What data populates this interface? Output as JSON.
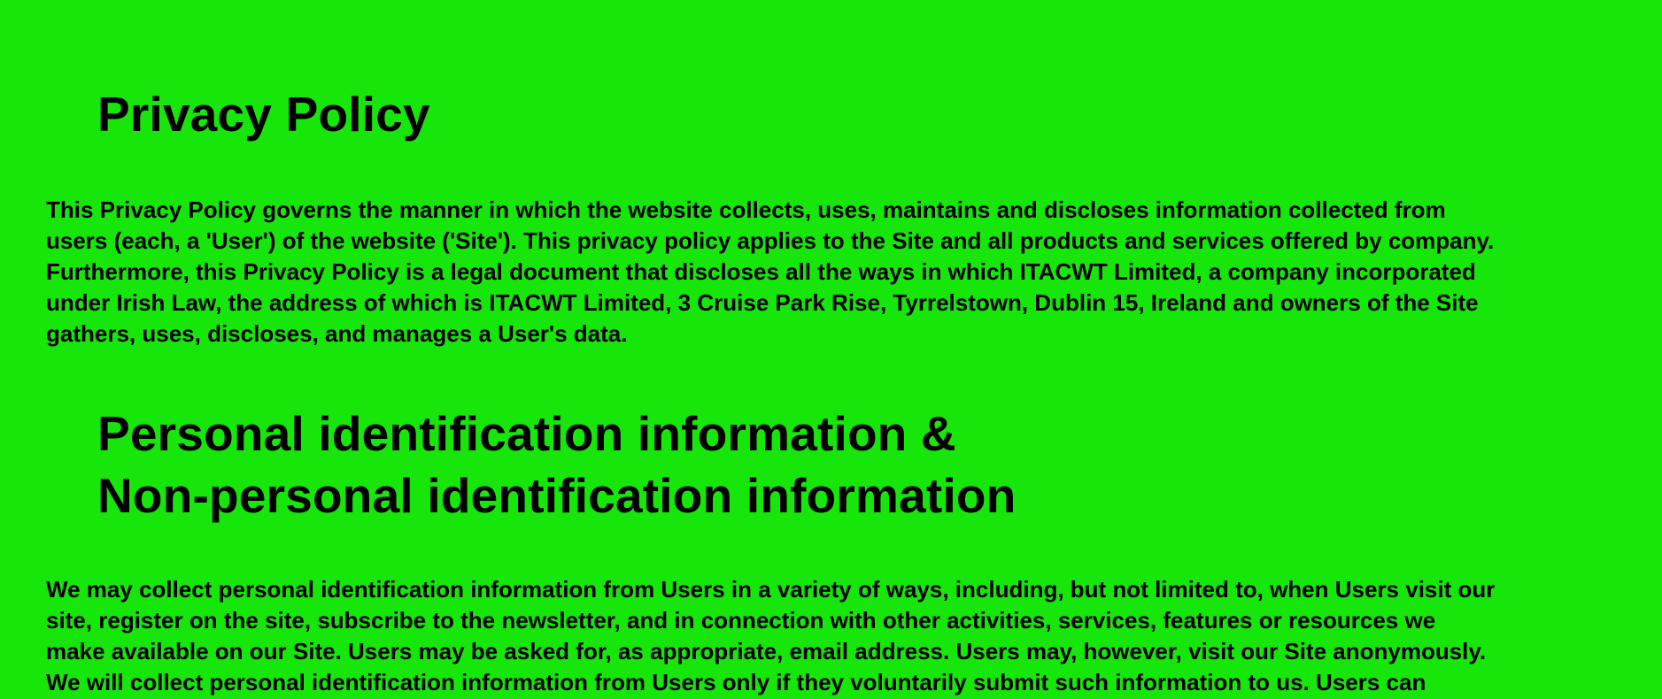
{
  "document": {
    "title": "Privacy Policy",
    "intro_lines": [
      "This Privacy Policy governs the manner in which the website collects, uses, maintains and discloses information collected from",
      "users (each, a 'User') of the website ('Site'). This privacy policy applies to the Site and all products and services offered by company.",
      "Furthermore, this Privacy Policy is a legal document that discloses all the ways in which ITACWT Limited, a company incorporated",
      "under Irish Law, the address of which is ITACWT Limited, 3 Cruise Park Rise, Tyrrelstown, Dublin 15, Ireland and owners of the Site",
      "gathers, uses, discloses, and manages a User's data."
    ],
    "section_heading_lines": [
      "Personal identification information &",
      "Non-personal identification information"
    ],
    "section_lines": [
      "We may collect personal identification information from Users in a variety of ways, including, but not limited to, when Users visit our",
      "site, register on the site, subscribe to the newsletter, and in connection with other activities, services, features or resources we",
      "make available on our Site. Users may be asked for, as appropriate, email address. Users may, however, visit our Site anonymously.",
      "We will collect personal identification information from Users only if they voluntarily submit such information to us. Users can"
    ]
  },
  "colors": {
    "background": "#16e60a",
    "text": "#000000"
  }
}
